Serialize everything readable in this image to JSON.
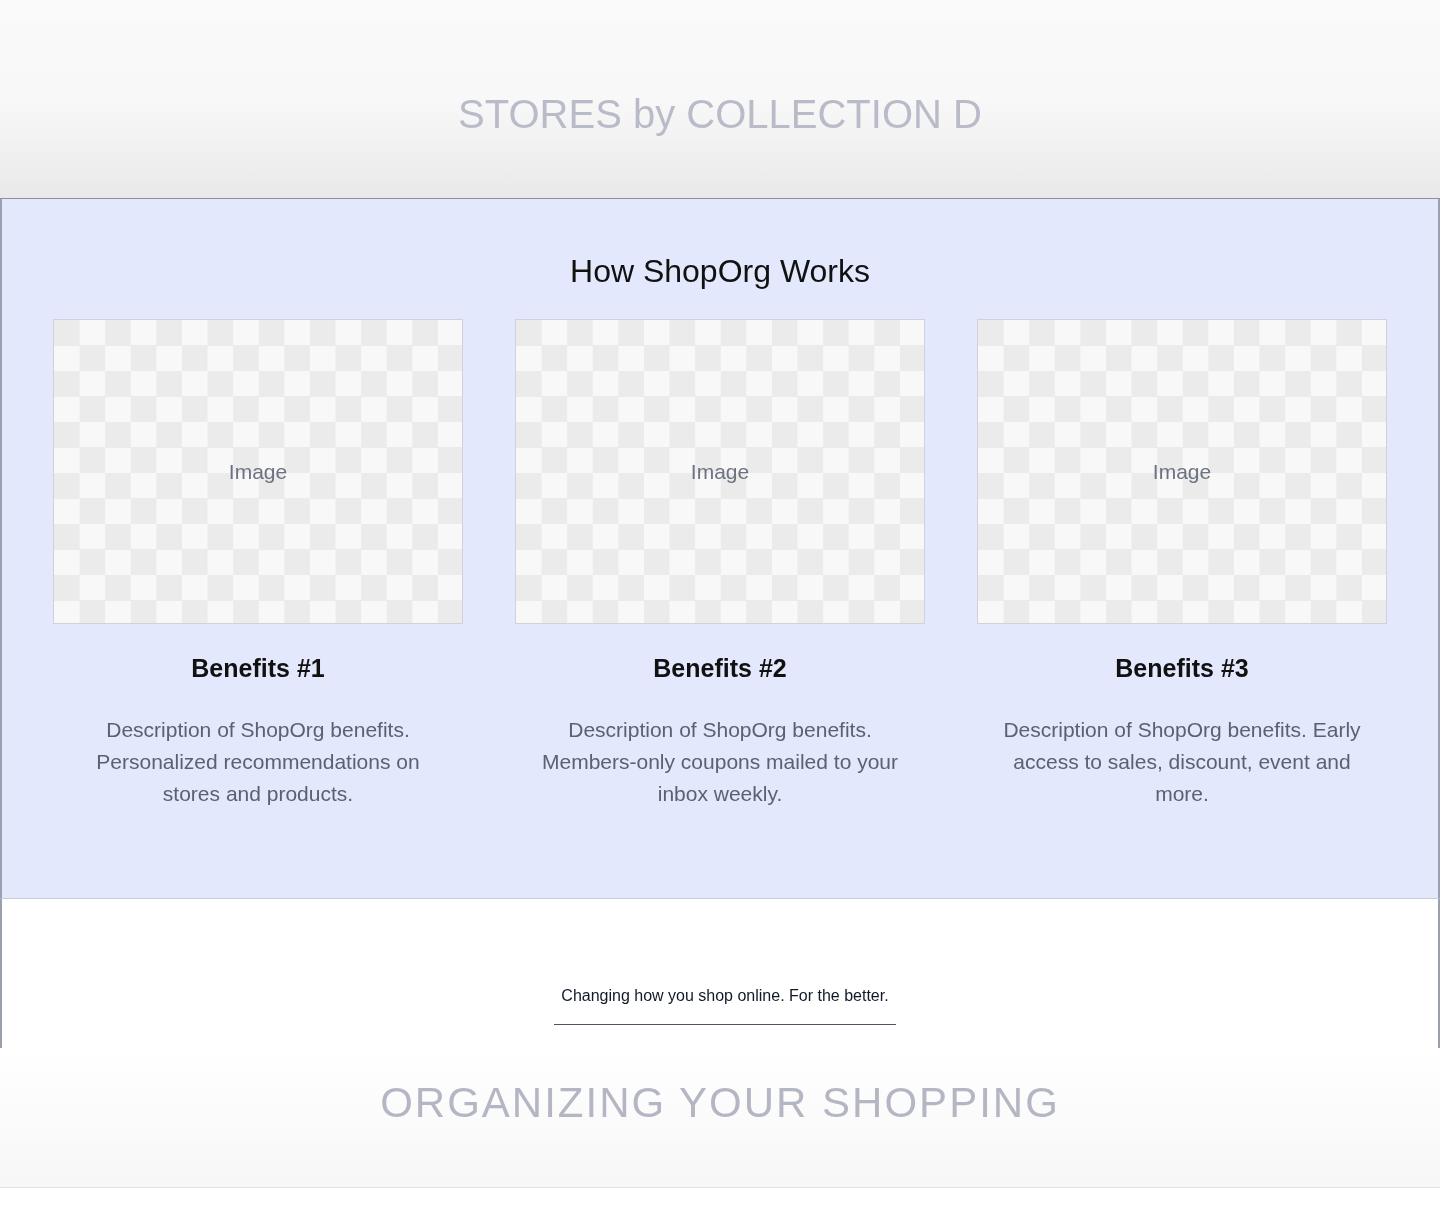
{
  "top_banner": {
    "heading": "STORES by COLLECTION D"
  },
  "how_it_works": {
    "title": "How ShopOrg Works",
    "cards": [
      {
        "image_label": "Image",
        "title": "Benefits #1",
        "description": "Description of ShopOrg benefits. Personalized recommendations on stores and products."
      },
      {
        "image_label": "Image",
        "title": "Benefits #2",
        "description": "Description of ShopOrg benefits. Members-only coupons mailed to your inbox weekly."
      },
      {
        "image_label": "Image",
        "title": "Benefits #3",
        "description": "Description of ShopOrg benefits. Early access to sales, discount, event and more."
      }
    ]
  },
  "tagline": {
    "text": "Changing how you shop online. For the better."
  },
  "bottom_banner": {
    "heading": "ORGANIZING YOUR SHOPPING"
  }
}
